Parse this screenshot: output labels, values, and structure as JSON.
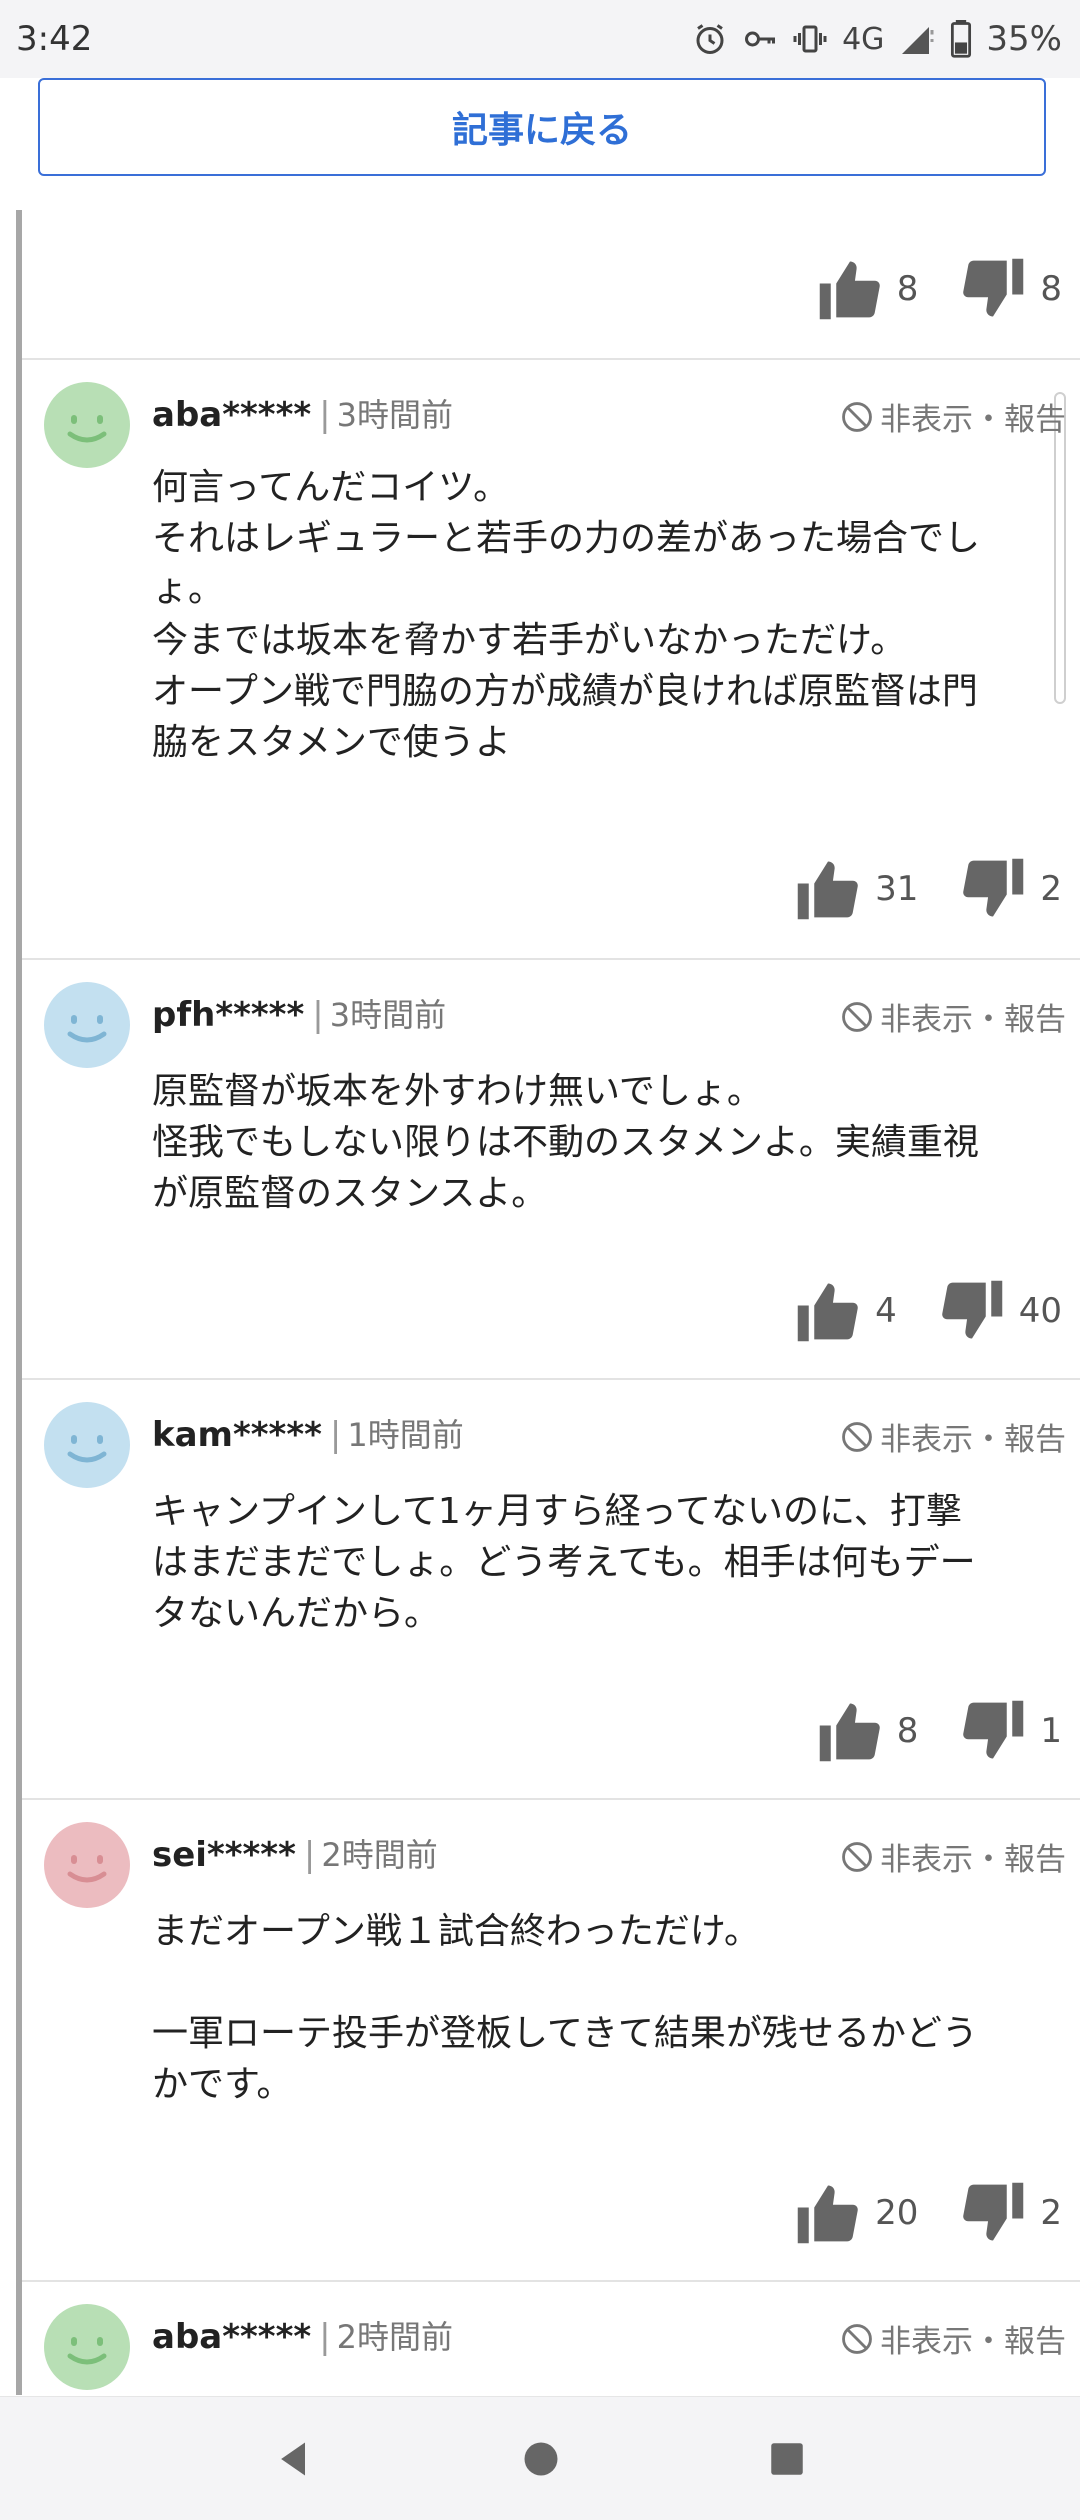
{
  "status_bar": {
    "time": "3:42",
    "network": "4G",
    "battery": "35%"
  },
  "back_button": {
    "label": "記事に戻る"
  },
  "top_votes": {
    "likes": "8",
    "dislikes": "8"
  },
  "comments": [
    {
      "username": "aba*****",
      "time": "3時間前",
      "avatar_color": "#b8dfb5",
      "hide_report": "非表示・報告",
      "body": "何言ってんだコイツ。\nそれはレギュラーと若手の力の差があった場合でし\nょ。\n今までは坂本を脅かす若手がいなかっただけ。\nオープン戦で門脇の方が成績が良ければ原監督は門\n脇をスタメンで使うよ",
      "likes": "31",
      "dislikes": "2"
    },
    {
      "username": "pfh*****",
      "time": "3時間前",
      "avatar_color": "#c3e0f0",
      "hide_report": "非表示・報告",
      "body": "原監督が坂本を外すわけ無いでしょ。\n怪我でもしない限りは不動のスタメンよ。実績重視\nが原監督のスタンスよ。",
      "likes": "4",
      "dislikes": "40"
    },
    {
      "username": "kam*****",
      "time": "1時間前",
      "avatar_color": "#c3e0f0",
      "hide_report": "非表示・報告",
      "body": "キャンプインして1ヶ月すら経ってないのに、打撃\nはまだまだでしょ。どう考えても。相手は何もデー\nタないんだから。",
      "likes": "8",
      "dislikes": "1"
    },
    {
      "username": "sei*****",
      "time": "2時間前",
      "avatar_color": "#ecbcc0",
      "hide_report": "非表示・報告",
      "body": "まだオープン戦１試合終わっただけ。\n\n一軍ローテ投手が登板してきて結果が残せるかどう\nかです。",
      "likes": "20",
      "dislikes": "2"
    },
    {
      "username": "aba*****",
      "time": "2時間前",
      "avatar_color": "#b8dfb5",
      "hide_report": "非表示・報告"
    }
  ],
  "colors": {
    "accent": "#2f6fd6",
    "thread_line": "#a7a7a7",
    "icon_gray": "#666666"
  },
  "icons": [
    "alarm-icon",
    "key-icon",
    "vibrate-icon",
    "signal-icon",
    "battery-icon",
    "thumbs-up-icon",
    "thumbs-down-icon",
    "block-icon",
    "back-nav-icon",
    "home-nav-icon",
    "recents-nav-icon"
  ]
}
